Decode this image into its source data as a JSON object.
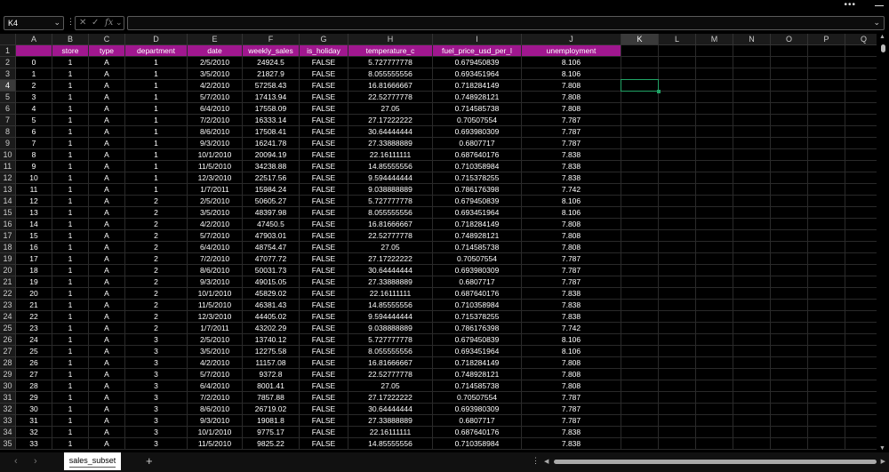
{
  "window": {
    "more_label": "•••"
  },
  "formula_bar": {
    "name_box": "K4",
    "separator": "⋮",
    "cancel_icon": "✕",
    "enter_icon": "✓",
    "fx_icon": "fx",
    "formula": ""
  },
  "active_cell": {
    "column": "K",
    "row": "4"
  },
  "columns": [
    "A",
    "B",
    "C",
    "D",
    "E",
    "F",
    "G",
    "H",
    "I",
    "J",
    "K",
    "L",
    "M",
    "N",
    "O",
    "P",
    "Q"
  ],
  "row_numbers": [
    "1",
    "2",
    "3",
    "4",
    "5",
    "6",
    "7",
    "8",
    "9",
    "10",
    "11",
    "12",
    "13",
    "14",
    "15",
    "16",
    "17",
    "18",
    "19",
    "20",
    "21",
    "22",
    "23",
    "24",
    "25",
    "26",
    "27",
    "28",
    "29",
    "30",
    "31",
    "32",
    "33",
    "34",
    "35"
  ],
  "headers": [
    "",
    "store",
    "type",
    "department",
    "date",
    "weekly_sales",
    "is_holiday",
    "temperature_c",
    "fuel_price_usd_per_l",
    "unemployment"
  ],
  "rows": [
    [
      "0",
      "1",
      "A",
      "1",
      "2/5/2010",
      "24924.5",
      "FALSE",
      "5.727777778",
      "0.679450839",
      "8.106"
    ],
    [
      "1",
      "1",
      "A",
      "1",
      "3/5/2010",
      "21827.9",
      "FALSE",
      "8.055555556",
      "0.693451964",
      "8.106"
    ],
    [
      "2",
      "1",
      "A",
      "1",
      "4/2/2010",
      "57258.43",
      "FALSE",
      "16.81666667",
      "0.718284149",
      "7.808"
    ],
    [
      "3",
      "1",
      "A",
      "1",
      "5/7/2010",
      "17413.94",
      "FALSE",
      "22.52777778",
      "0.748928121",
      "7.808"
    ],
    [
      "4",
      "1",
      "A",
      "1",
      "6/4/2010",
      "17558.09",
      "FALSE",
      "27.05",
      "0.714585738",
      "7.808"
    ],
    [
      "5",
      "1",
      "A",
      "1",
      "7/2/2010",
      "16333.14",
      "FALSE",
      "27.17222222",
      "0.70507554",
      "7.787"
    ],
    [
      "6",
      "1",
      "A",
      "1",
      "8/6/2010",
      "17508.41",
      "FALSE",
      "30.64444444",
      "0.693980309",
      "7.787"
    ],
    [
      "7",
      "1",
      "A",
      "1",
      "9/3/2010",
      "16241.78",
      "FALSE",
      "27.33888889",
      "0.6807717",
      "7.787"
    ],
    [
      "8",
      "1",
      "A",
      "1",
      "10/1/2010",
      "20094.19",
      "FALSE",
      "22.16111111",
      "0.687640176",
      "7.838"
    ],
    [
      "9",
      "1",
      "A",
      "1",
      "11/5/2010",
      "34238.88",
      "FALSE",
      "14.85555556",
      "0.710358984",
      "7.838"
    ],
    [
      "10",
      "1",
      "A",
      "1",
      "12/3/2010",
      "22517.56",
      "FALSE",
      "9.594444444",
      "0.715378255",
      "7.838"
    ],
    [
      "11",
      "1",
      "A",
      "1",
      "1/7/2011",
      "15984.24",
      "FALSE",
      "9.038888889",
      "0.786176398",
      "7.742"
    ],
    [
      "12",
      "1",
      "A",
      "2",
      "2/5/2010",
      "50605.27",
      "FALSE",
      "5.727777778",
      "0.679450839",
      "8.106"
    ],
    [
      "13",
      "1",
      "A",
      "2",
      "3/5/2010",
      "48397.98",
      "FALSE",
      "8.055555556",
      "0.693451964",
      "8.106"
    ],
    [
      "14",
      "1",
      "A",
      "2",
      "4/2/2010",
      "47450.5",
      "FALSE",
      "16.81666667",
      "0.718284149",
      "7.808"
    ],
    [
      "15",
      "1",
      "A",
      "2",
      "5/7/2010",
      "47903.01",
      "FALSE",
      "22.52777778",
      "0.748928121",
      "7.808"
    ],
    [
      "16",
      "1",
      "A",
      "2",
      "6/4/2010",
      "48754.47",
      "FALSE",
      "27.05",
      "0.714585738",
      "7.808"
    ],
    [
      "17",
      "1",
      "A",
      "2",
      "7/2/2010",
      "47077.72",
      "FALSE",
      "27.17222222",
      "0.70507554",
      "7.787"
    ],
    [
      "18",
      "1",
      "A",
      "2",
      "8/6/2010",
      "50031.73",
      "FALSE",
      "30.64444444",
      "0.693980309",
      "7.787"
    ],
    [
      "19",
      "1",
      "A",
      "2",
      "9/3/2010",
      "49015.05",
      "FALSE",
      "27.33888889",
      "0.6807717",
      "7.787"
    ],
    [
      "20",
      "1",
      "A",
      "2",
      "10/1/2010",
      "45829.02",
      "FALSE",
      "22.16111111",
      "0.687640176",
      "7.838"
    ],
    [
      "21",
      "1",
      "A",
      "2",
      "11/5/2010",
      "46381.43",
      "FALSE",
      "14.85555556",
      "0.710358984",
      "7.838"
    ],
    [
      "22",
      "1",
      "A",
      "2",
      "12/3/2010",
      "44405.02",
      "FALSE",
      "9.594444444",
      "0.715378255",
      "7.838"
    ],
    [
      "23",
      "1",
      "A",
      "2",
      "1/7/2011",
      "43202.29",
      "FALSE",
      "9.038888889",
      "0.786176398",
      "7.742"
    ],
    [
      "24",
      "1",
      "A",
      "3",
      "2/5/2010",
      "13740.12",
      "FALSE",
      "5.727777778",
      "0.679450839",
      "8.106"
    ],
    [
      "25",
      "1",
      "A",
      "3",
      "3/5/2010",
      "12275.58",
      "FALSE",
      "8.055555556",
      "0.693451964",
      "8.106"
    ],
    [
      "26",
      "1",
      "A",
      "3",
      "4/2/2010",
      "11157.08",
      "FALSE",
      "16.81666667",
      "0.718284149",
      "7.808"
    ],
    [
      "27",
      "1",
      "A",
      "3",
      "5/7/2010",
      "9372.8",
      "FALSE",
      "22.52777778",
      "0.748928121",
      "7.808"
    ],
    [
      "28",
      "1",
      "A",
      "3",
      "6/4/2010",
      "8001.41",
      "FALSE",
      "27.05",
      "0.714585738",
      "7.808"
    ],
    [
      "29",
      "1",
      "A",
      "3",
      "7/2/2010",
      "7857.88",
      "FALSE",
      "27.17222222",
      "0.70507554",
      "7.787"
    ],
    [
      "30",
      "1",
      "A",
      "3",
      "8/6/2010",
      "26719.02",
      "FALSE",
      "30.64444444",
      "0.693980309",
      "7.787"
    ],
    [
      "31",
      "1",
      "A",
      "3",
      "9/3/2010",
      "19081.8",
      "FALSE",
      "27.33888889",
      "0.6807717",
      "7.787"
    ],
    [
      "32",
      "1",
      "A",
      "3",
      "10/1/2010",
      "9775.17",
      "FALSE",
      "22.16111111",
      "0.687640176",
      "7.838"
    ],
    [
      "33",
      "1",
      "A",
      "3",
      "11/5/2010",
      "9825.22",
      "FALSE",
      "14.85555556",
      "0.710358984",
      "7.838"
    ]
  ],
  "sheets": [
    {
      "name": "sales_subset",
      "active": true
    }
  ],
  "tabbar": {
    "prev_icon": "‹",
    "next_icon": "›",
    "add_label": "+",
    "more_label": "⋮"
  },
  "colors": {
    "header_row": "#a0178f",
    "selection": "#21a366",
    "background": "#000000"
  }
}
